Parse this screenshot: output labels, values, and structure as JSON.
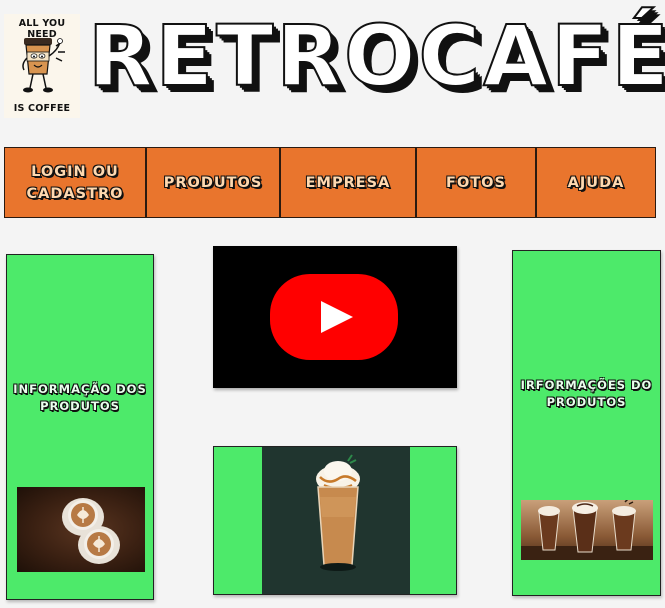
{
  "logo": {
    "line_top": "ALL YOU NEED",
    "line_bottom": "IS COFFEE",
    "icon": "coffee-cup-mascot-icon"
  },
  "site_title": "RETROCAFÉ",
  "nav": {
    "items": [
      {
        "label": "LOGIN OU CADASTRO"
      },
      {
        "label": "PRODUTOS"
      },
      {
        "label": "EMPRESA"
      },
      {
        "label": "FOTOS"
      },
      {
        "label": "AJUDA"
      }
    ]
  },
  "left_card": {
    "label": "INFORMAÇÃO DOS PRODUTOS",
    "image": "latte-art-cups"
  },
  "right_card": {
    "label": "IRFORMAÇÕES DO PRODUTOS",
    "image": "iced-mochas"
  },
  "video": {
    "icon": "youtube-play-icon"
  },
  "center_image": "caramel-frappuccino",
  "colors": {
    "nav_bg": "#e9752d",
    "card_bg": "#4dea6a",
    "youtube_red": "#ff0000",
    "page_bg": "#f4f4f4"
  }
}
